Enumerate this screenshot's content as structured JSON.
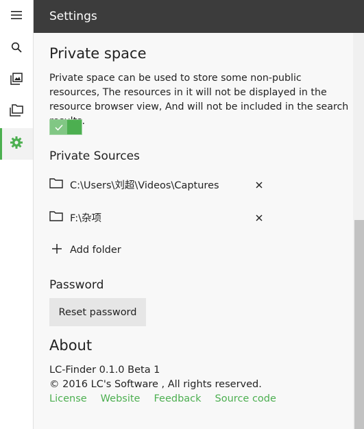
{
  "header": {
    "title": "Settings"
  },
  "sidebar": {
    "items": [
      {
        "name": "menu",
        "icon": "hamburger-menu-icon"
      },
      {
        "name": "search",
        "icon": "search-icon"
      },
      {
        "name": "photos",
        "icon": "image-gallery-icon"
      },
      {
        "name": "folders",
        "icon": "folders-icon"
      },
      {
        "name": "settings",
        "icon": "gear-icon",
        "active": true
      }
    ]
  },
  "private_space": {
    "title": "Private space",
    "description": "Private space can be used to store some non-public resources, The resources in it will not be displayed in the resource browser view, And will not be included in the search results.",
    "toggle_on": true
  },
  "private_sources": {
    "title": "Private Sources",
    "folders": [
      "C:\\Users\\刘超\\Videos\\Captures",
      "F:\\杂项"
    ],
    "add_label": "Add folder"
  },
  "password": {
    "title": "Password",
    "reset_label": "Reset password"
  },
  "about": {
    "title": "About",
    "version": "LC-Finder 0.1.0 Beta 1",
    "copyright": "© 2016 LC's Software , All rights reserved.",
    "links": [
      "License",
      "Website",
      "Feedback",
      "Source code"
    ]
  },
  "colors": {
    "accent": "#4caf50",
    "header_bg": "#3c3c3c"
  }
}
